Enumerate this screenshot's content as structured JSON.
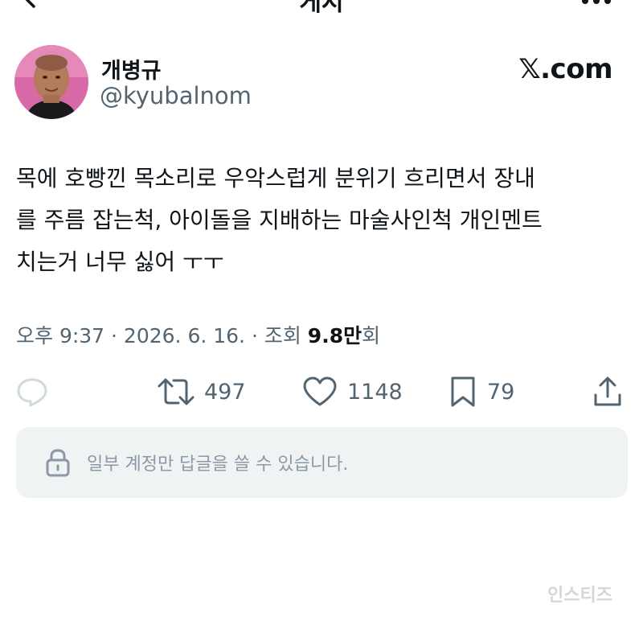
{
  "header": {
    "title": "게시"
  },
  "author": {
    "display_name": "개병규",
    "handle": "@kyubalnom"
  },
  "brand": {
    "label": "𝕏.com"
  },
  "tweet": {
    "lines": [
      "목에 호빵낀 목소리로 우악스럽게 분위기 흐리면서 장내",
      "를 주름 잡는척, 아이돌을 지배하는 마술사인척 개인멘트",
      "치는거 너무 싫어 ㅜㅜ"
    ]
  },
  "meta": {
    "time_date": "오후 9:37 · 2026. 6. 16. · 조회 ",
    "views": "9.8만",
    "views_suffix": "회"
  },
  "actions": {
    "retweets": "497",
    "likes": "1148",
    "bookmarks": "79"
  },
  "reply_restriction": {
    "text": "일부 계정만 답글을 쓸 수 있습니다."
  },
  "watermark": {
    "text": "인스티즈"
  },
  "colors": {
    "accent": "#0f1419",
    "muted": "#536471",
    "reply_bar_bg": "#eff3f4",
    "icon_light": "#cfd9de"
  }
}
